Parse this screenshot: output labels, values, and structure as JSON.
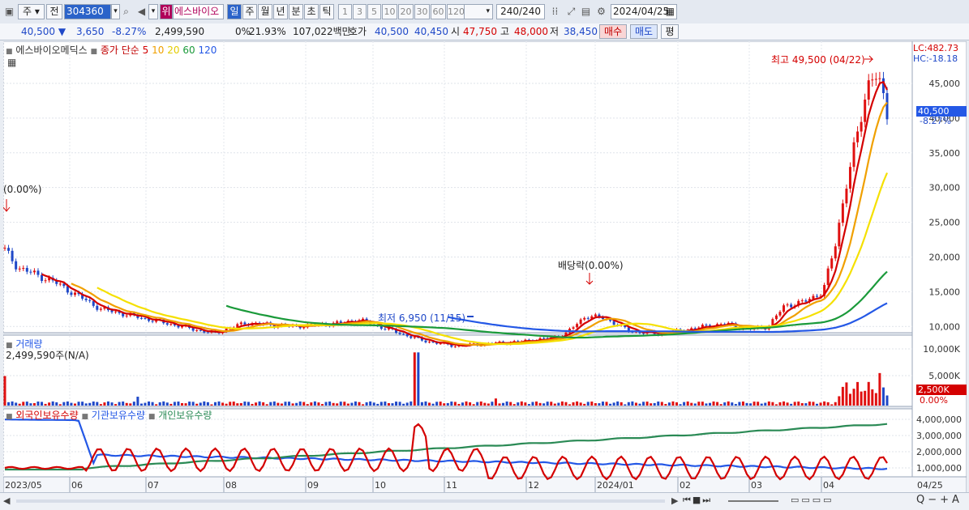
{
  "toolbar": {
    "market_sel": "주",
    "period_sel": "전",
    "stock_code": "304360",
    "warn_badge": "위",
    "stock_name": "에스바이오",
    "timeframes": [
      "일",
      "주",
      "월",
      "년",
      "분",
      "초",
      "틱"
    ],
    "active_timeframe": "일",
    "intervals": [
      "1",
      "3",
      "5",
      "10",
      "20",
      "30",
      "60",
      "120"
    ],
    "count": "240",
    "count_total": "/240",
    "date": "2024/04/25"
  },
  "quote": {
    "price": "40,500",
    "arrow": "▼",
    "change": "3,650",
    "change_pct": "-8.27%",
    "volume": "2,499,590",
    "turnover_label": "0%",
    "turnover": "21.93%",
    "amount": "107,022백만",
    "ask_label": "호가",
    "ask": "40,500",
    "bid": "40,450",
    "open_label": "시",
    "open": "47,750",
    "high_label": "고",
    "high": "48,000",
    "low_label": "저",
    "low": "38,450",
    "buy_button": "매수",
    "sell_button": "매도",
    "eval_button": "평"
  },
  "legend": {
    "name": "에스바이오메딕스",
    "type": "종가 단순",
    "ma_periods": [
      "5",
      "10",
      "20",
      "60",
      "120"
    ],
    "ma_colors": [
      "#d40000",
      "#f0a000",
      "#f5e000",
      "#1a9a3a",
      "#2458e6"
    ]
  },
  "annotations": {
    "lc": "LC:482.73",
    "hc": "HC:-18.18",
    "high_note": "최고 49,500 (04/22)",
    "low_note": "최저 6,950 (11/15)",
    "div_note": "배당락(0.00%)",
    "left_note": "(0.00%)",
    "price_tag": "40,500",
    "price_tag_pct": "-8.27%"
  },
  "price_axis": [
    "45,000",
    "40,000",
    "35,000",
    "30,000",
    "25,000",
    "20,000",
    "15,000",
    "10,000"
  ],
  "volume_panel": {
    "title": "거래량",
    "value": "2,499,590주(N/A)",
    "axis": [
      "10,000K",
      "5,000K"
    ],
    "tag": "2,500K",
    "tag_pct": "0.00%"
  },
  "holding_panel": {
    "series": [
      "외국인보유수량",
      "기관보유수량",
      "개인보유수량"
    ],
    "colors": [
      "#d40000",
      "#2458e6",
      "#2a8a55"
    ],
    "axis": [
      "4,000,000",
      "3,000,000",
      "2,000,000",
      "1,000,000"
    ]
  },
  "time_axis": [
    "2023/05",
    "06",
    "07",
    "08",
    "09",
    "10",
    "11",
    "12",
    "2024/01",
    "02",
    "03",
    "04"
  ],
  "time_axis_right": "04/25"
}
